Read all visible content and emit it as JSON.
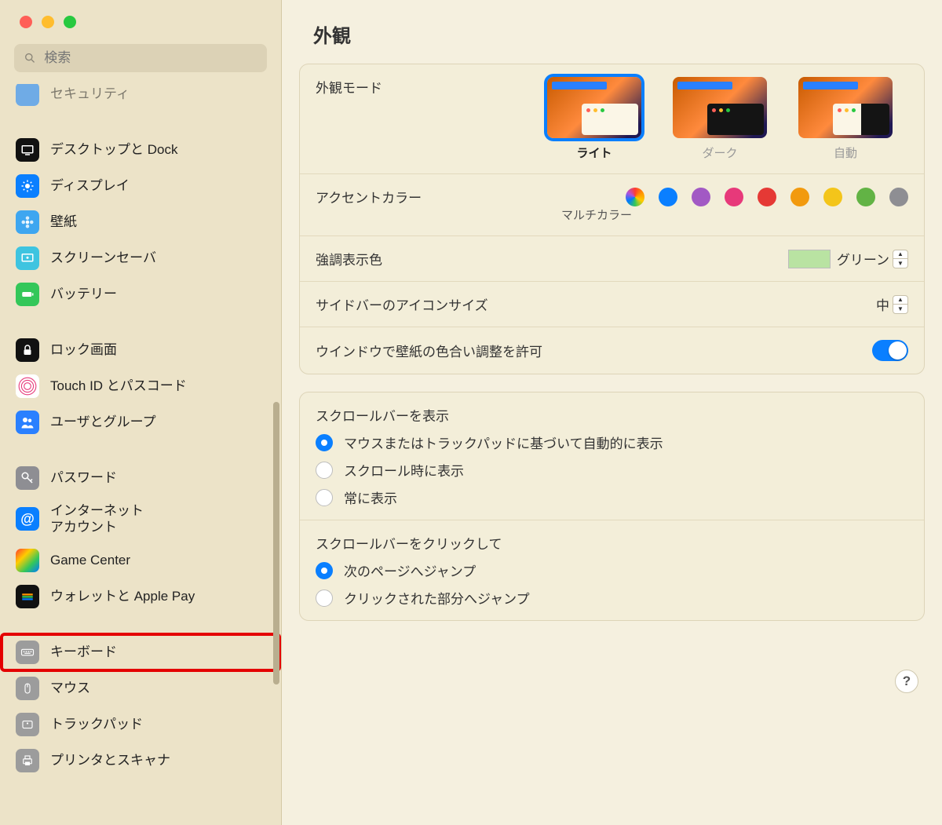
{
  "search": {
    "placeholder": "検索"
  },
  "sidebar": {
    "items": [
      {
        "label": "セキュリティ",
        "icon": "security"
      },
      {
        "label": "デスクトップと Dock",
        "icon": "desktop"
      },
      {
        "label": "ディスプレイ",
        "icon": "display"
      },
      {
        "label": "壁紙",
        "icon": "wallpaper"
      },
      {
        "label": "スクリーンセーバ",
        "icon": "screensaver"
      },
      {
        "label": "バッテリー",
        "icon": "battery"
      },
      {
        "label": "ロック画面",
        "icon": "lock"
      },
      {
        "label": "Touch ID とパスコード",
        "icon": "touchid"
      },
      {
        "label": "ユーザとグループ",
        "icon": "users"
      },
      {
        "label": "パスワード",
        "icon": "password"
      },
      {
        "label": "インターネット\nアカウント",
        "icon": "internet"
      },
      {
        "label": "Game Center",
        "icon": "gamecenter"
      },
      {
        "label": "ウォレットと Apple Pay",
        "icon": "wallet"
      },
      {
        "label": "キーボード",
        "icon": "keyboard"
      },
      {
        "label": "マウス",
        "icon": "mouse"
      },
      {
        "label": "トラックパッド",
        "icon": "trackpad"
      },
      {
        "label": "プリンタとスキャナ",
        "icon": "printer"
      }
    ]
  },
  "main": {
    "title": "外観",
    "appearanceMode": {
      "label": "外観モード",
      "options": [
        {
          "name": "ライト",
          "selected": true,
          "variant": "light"
        },
        {
          "name": "ダーク",
          "selected": false,
          "variant": "dark"
        },
        {
          "name": "自動",
          "selected": false,
          "variant": "split"
        }
      ]
    },
    "accentColor": {
      "label": "アクセントカラー",
      "selectedLabel": "マルチカラー",
      "colors": [
        "multicolor",
        "#0a7fff",
        "#a259c4",
        "#e7397a",
        "#e53935",
        "#f29a0e",
        "#f3c51a",
        "#62b345",
        "#8e8e93"
      ]
    },
    "highlight": {
      "label": "強調表示色",
      "value": "グリーン",
      "swatch": "#b9e3a2"
    },
    "sidebarIconSize": {
      "label": "サイドバーのアイコンサイズ",
      "value": "中"
    },
    "wallpaperTinting": {
      "label": "ウインドウで壁紙の色合い調整を許可",
      "on": true
    },
    "scrollbar": {
      "label": "スクロールバーを表示",
      "options": [
        {
          "label": "マウスまたはトラックパッドに基づいて自動的に表示",
          "selected": true
        },
        {
          "label": "スクロール時に表示",
          "selected": false
        },
        {
          "label": "常に表示",
          "selected": false
        }
      ]
    },
    "scrollbarClick": {
      "label": "スクロールバーをクリックして",
      "options": [
        {
          "label": "次のページへジャンプ",
          "selected": true
        },
        {
          "label": "クリックされた部分へジャンプ",
          "selected": false
        }
      ]
    },
    "help": "?"
  }
}
